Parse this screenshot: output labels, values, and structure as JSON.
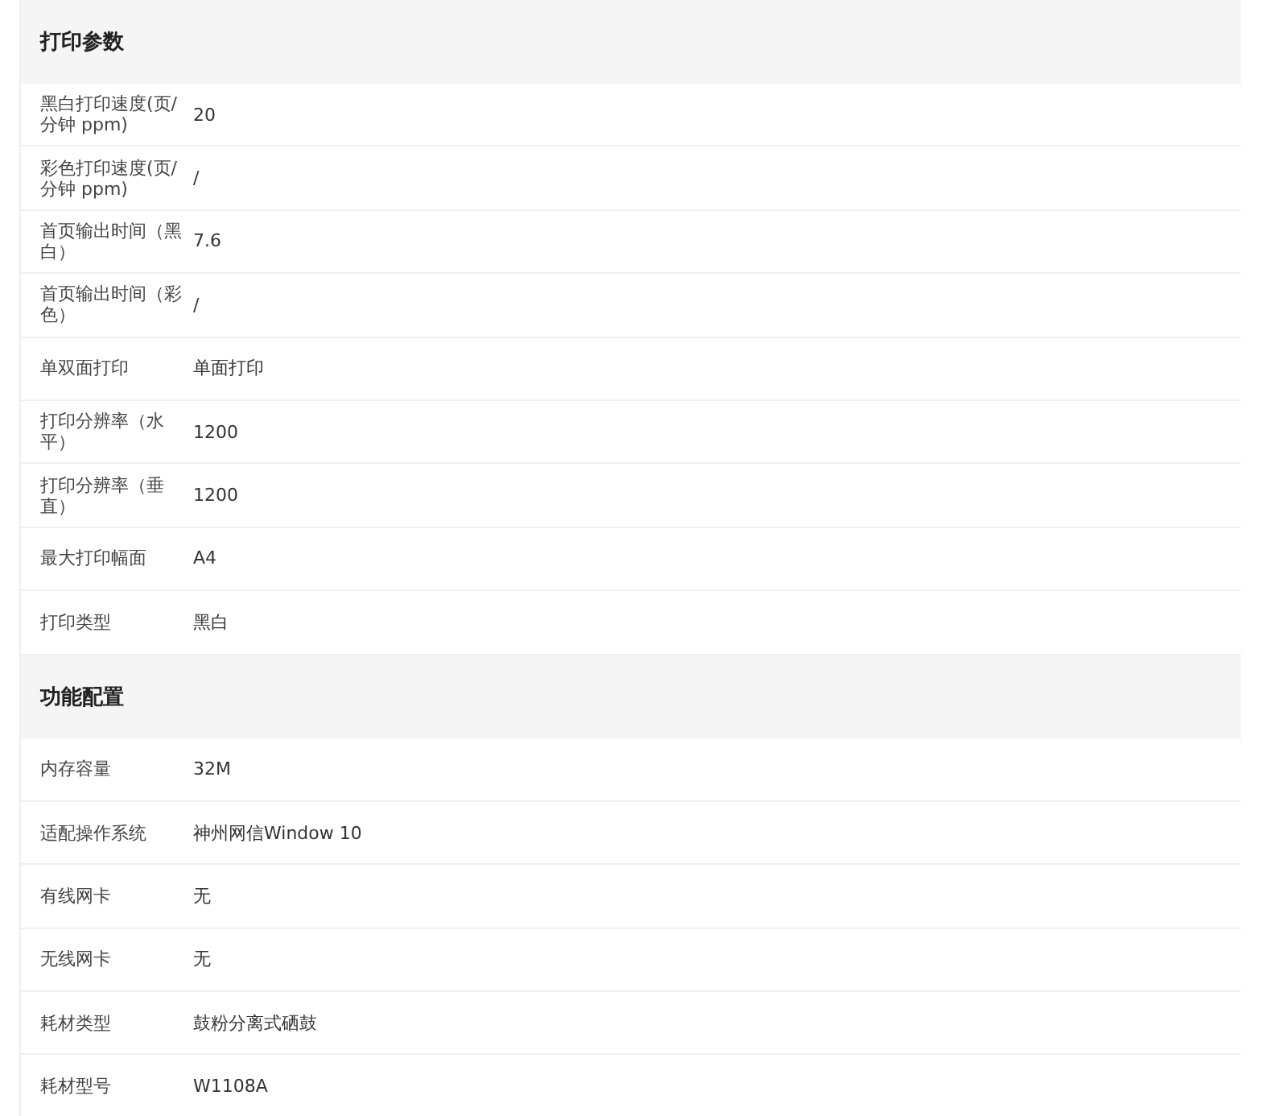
{
  "sections": [
    {
      "title": "打印参数",
      "rows": [
        {
          "label": "黑白打印速度(页/分钟 ppm)",
          "value": "20"
        },
        {
          "label": "彩色打印速度(页/分钟 ppm)",
          "value": "/"
        },
        {
          "label": "首页输出时间（黑白）",
          "value": "7.6"
        },
        {
          "label": "首页输出时间（彩色）",
          "value": "/"
        },
        {
          "label": "单双面打印",
          "value": "单面打印"
        },
        {
          "label": "打印分辨率（水平）",
          "value": "1200"
        },
        {
          "label": "打印分辨率（垂直）",
          "value": "1200"
        },
        {
          "label": "最大打印幅面",
          "value": "A4"
        },
        {
          "label": "打印类型",
          "value": "黑白"
        }
      ]
    },
    {
      "title": "功能配置",
      "rows": [
        {
          "label": "内存容量",
          "value": "32M"
        },
        {
          "label": "适配操作系统",
          "value": "神州网信Window 10"
        },
        {
          "label": "有线网卡",
          "value": "无"
        },
        {
          "label": "无线网卡",
          "value": "无"
        },
        {
          "label": "耗材类型",
          "value": "鼓粉分离式硒鼓"
        },
        {
          "label": "耗材型号",
          "value": "W1108A"
        }
      ]
    }
  ]
}
